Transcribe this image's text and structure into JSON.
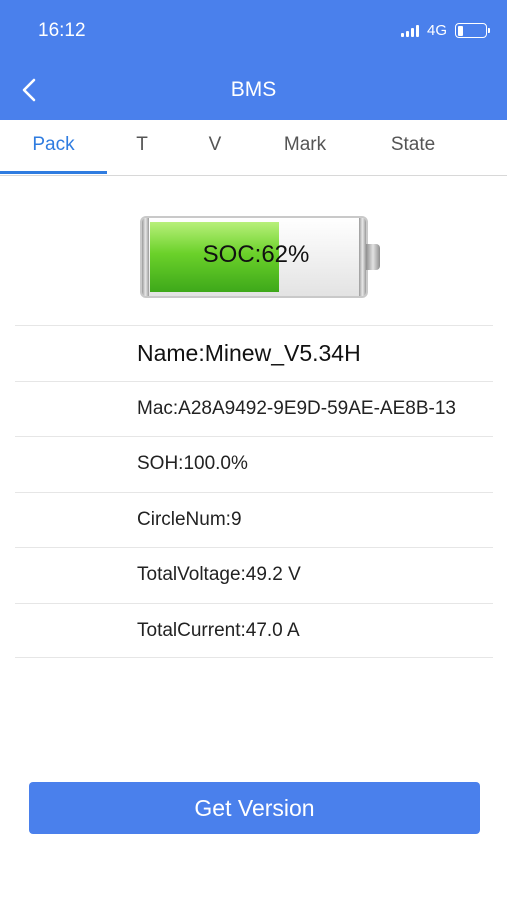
{
  "status_bar": {
    "time": "16:12",
    "network": "4G",
    "signal_icon": "signal-bars-icon",
    "battery_icon": "battery-status-icon"
  },
  "header": {
    "title": "BMS",
    "back_icon": "chevron-left-icon",
    "background_color": "#4a80ec"
  },
  "tabs": [
    {
      "label": "Pack",
      "active": true
    },
    {
      "label": "T",
      "active": false
    },
    {
      "label": "V",
      "active": false
    },
    {
      "label": "Mark",
      "active": false
    },
    {
      "label": "State",
      "active": false
    }
  ],
  "battery": {
    "soc_label": "SOC:62%",
    "soc_fraction": 0.62,
    "fill_color": "#6bd12a"
  },
  "info": {
    "name": "Name:Minew_V5.34H",
    "mac": "Mac:A28A9492-9E9D-59AE-AE8B-13",
    "soh": "SOH:100.0%",
    "circle_num": "CircleNum:9",
    "total_voltage": "TotalVoltage:49.2 V",
    "total_current": "TotalCurrent:47.0 A"
  },
  "actions": {
    "get_version_label": "Get Version",
    "accent_color": "#4a80ec"
  }
}
